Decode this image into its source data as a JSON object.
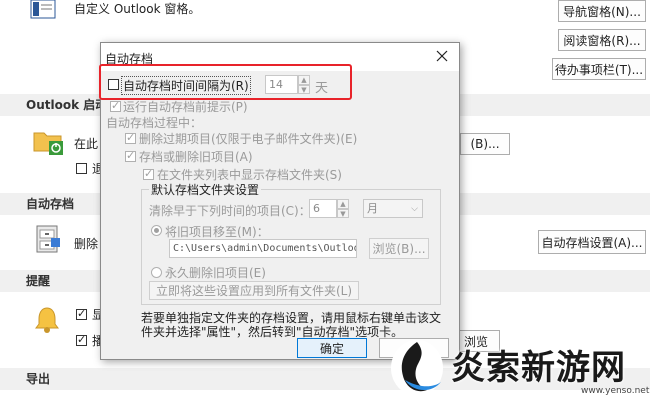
{
  "background": {
    "top_text": "自定义 Outlook 窗格。",
    "nav_pane_button": "导航窗格(N)...",
    "reading_pane_button": "阅读窗格(R)...",
    "todo_bar_button": "待办事项栏(T)...",
    "outlook_start_section": "Outlook 启动",
    "start_text": "在此",
    "start_check_label": "退",
    "browse_button": "(B)...",
    "autoarchive_section": "自动存档",
    "autoarchive_text": "删除",
    "autoarchive_settings_button": "自动存档设置(A)...",
    "reminder_section": "提醒",
    "reminder_item1": "显",
    "reminder_item2": "播",
    "reminder_button": "浏览",
    "export_section": "导出"
  },
  "dialog": {
    "title": "自动存档",
    "run_interval_label": "自动存档时间间隔为(R)",
    "run_interval_value": "14",
    "run_interval_unit": "天",
    "prompt_label": "运行自动存档前提示(P)",
    "during_label": "自动存档过程中：",
    "delete_expired_label": "删除过期项目(仅限于电子邮件文件夹)(E)",
    "archive_old_label": "存档或删除旧项目(A)",
    "show_folder_label": "在文件夹列表中显示存档文件夹(S)",
    "default_group_title": "默认存档文件夹设置",
    "clean_older_label": "清除早于下列时间的项目(C)：",
    "clean_older_value": "6",
    "clean_older_unit": "月",
    "move_old_label": "将旧项目移至(M)：",
    "move_path": "C:\\Users\\admin\\Documents\\Outloo",
    "browse_button": "浏览(B)...",
    "delete_permanent_label": "永久删除旧项目(E)",
    "apply_all_button": "立即将这些设置应用到所有文件夹(L)",
    "hint_text_1": "若要单独指定文件夹的存档设置，请用鼠标右键单击该文",
    "hint_text_2": "件夹并选择\"属性\"，然后转到\"自动存档\"选项卡。",
    "ok_button": "确定"
  },
  "watermark": {
    "text": "炎索新游网",
    "url": "www.yenso.net"
  },
  "colors": {
    "highlight_border": "#e8232a",
    "section_bg": "#f0f0f0",
    "ok_focus": "#0078d7"
  }
}
